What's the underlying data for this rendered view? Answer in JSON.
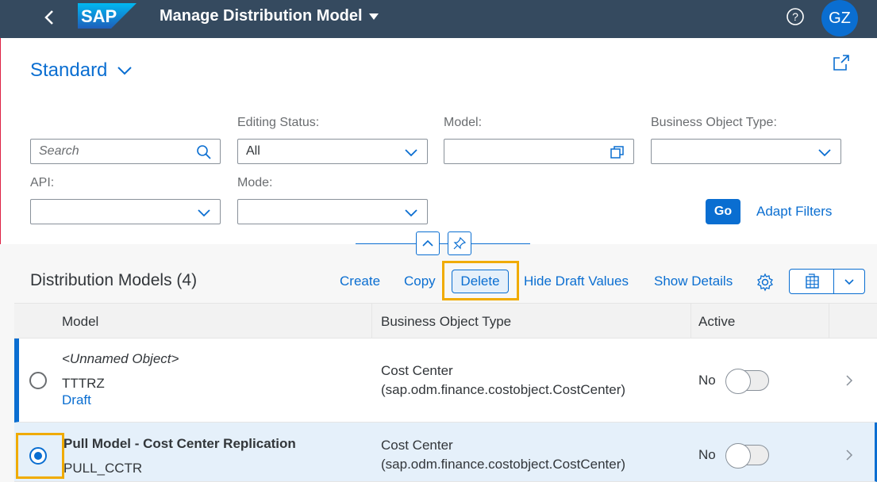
{
  "shell": {
    "title": "Manage Distribution Model",
    "logo_text": "SAP",
    "avatar_initials": "GZ",
    "icons": [
      "back-icon",
      "help-icon",
      "dropdown-icon"
    ]
  },
  "header": {
    "variant": "Standard",
    "filters": {
      "search_placeholder": "Search",
      "editing_status_label": "Editing Status:",
      "editing_status_value": "All",
      "model_label": "Model:",
      "model_value": "",
      "bo_type_label": "Business Object Type:",
      "bo_type_value": "",
      "api_label": "API:",
      "api_value": "",
      "mode_label": "Mode:",
      "mode_value": ""
    },
    "go_label": "Go",
    "adapt_filters_label": "Adapt Filters"
  },
  "table": {
    "title": "Distribution Models (4)",
    "toolbar": {
      "create": "Create",
      "copy": "Copy",
      "delete": "Delete",
      "hide_draft": "Hide Draft Values",
      "show_details": "Show Details"
    },
    "columns": [
      "Model",
      "Business Object Type",
      "Active"
    ],
    "rows": [
      {
        "name": "<Unnamed Object>",
        "id": "TTTRZ",
        "status": "Draft",
        "bo_type_line1": "Cost Center",
        "bo_type_line2": "(sap.odm.finance.costobject.CostCenter)",
        "active": "No",
        "selected": false
      },
      {
        "name": "Pull Model - Cost Center Replication",
        "id": "PULL_CCTR",
        "bo_type_line1": "Cost Center",
        "bo_type_line2": "(sap.odm.finance.costobject.CostCenter)",
        "active": "No",
        "selected": true
      }
    ]
  },
  "colors": {
    "shell": "#354a5f",
    "accent": "#0a6ed1",
    "highlight": "#f0ab00"
  }
}
